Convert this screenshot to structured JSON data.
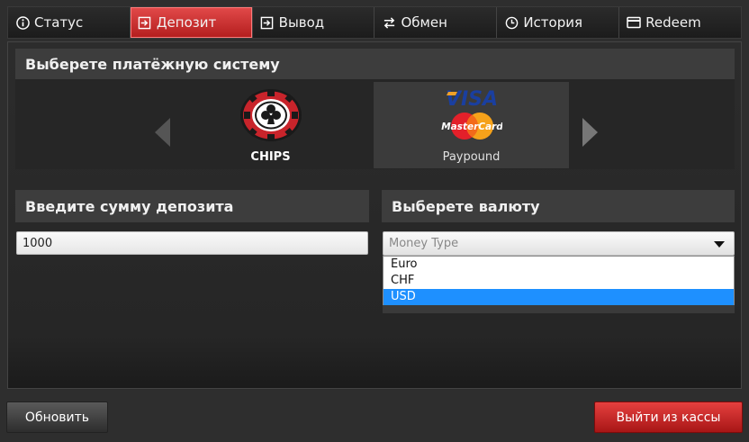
{
  "tabs": [
    {
      "label": "Статус",
      "icon": "info-icon"
    },
    {
      "label": "Депозит",
      "icon": "deposit-icon",
      "active": true
    },
    {
      "label": "Вывод",
      "icon": "withdraw-icon"
    },
    {
      "label": "Обмен",
      "icon": "exchange-icon"
    },
    {
      "label": "История",
      "icon": "clock-icon"
    },
    {
      "label": "Redeem",
      "icon": "card-icon"
    }
  ],
  "payment": {
    "header": "Выберете платёжную систему",
    "options": [
      {
        "label": "CHIPS",
        "icon": "chips-icon"
      },
      {
        "label": "Paypound",
        "icon": "visa-mastercard-icon",
        "selected": true
      }
    ]
  },
  "amount": {
    "header": "Введите сумму депозита",
    "value": "1000"
  },
  "currency": {
    "header": "Выберете валюту",
    "placeholder": "Money Type",
    "options": [
      "Euro",
      "CHF",
      "USD"
    ],
    "highlighted": "USD"
  },
  "buttons": {
    "refresh": "Обновить",
    "exit": "Выйти из кассы"
  },
  "colors": {
    "accent_red": "#c62828",
    "highlight_blue": "#1e90ff",
    "background": "#2e2e2e"
  }
}
